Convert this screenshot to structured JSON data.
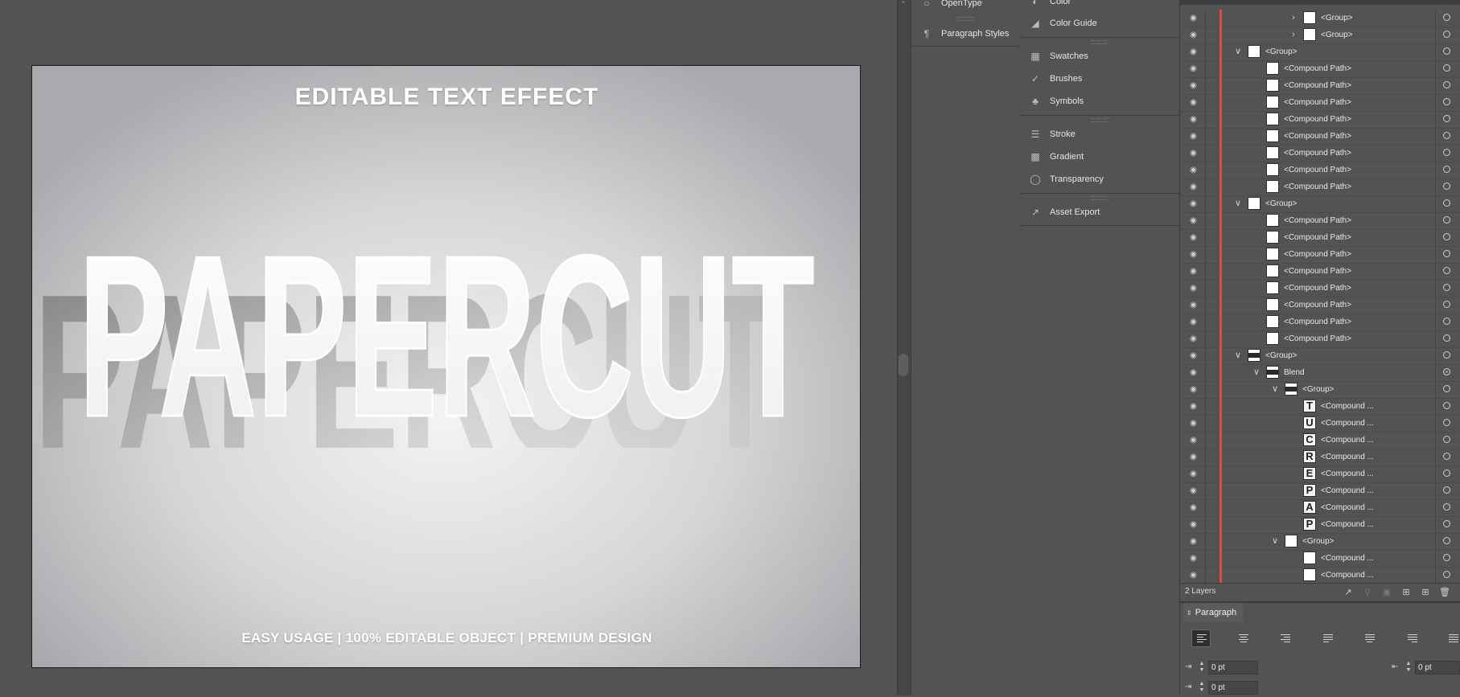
{
  "artboard": {
    "heading": "EDITABLE TEXT EFFECT",
    "main_text": "PAPERCUT",
    "footer": "EASY USAGE | 100% EDITABLE OBJECT | PREMIUM DESIGN"
  },
  "panel_col1": {
    "items": [
      {
        "label": "OpenType",
        "icon": "opentype-icon"
      },
      {
        "label": "Paragraph Styles",
        "icon": "paragraph-styles-icon"
      }
    ]
  },
  "panel_col2": {
    "items": [
      {
        "label": "Color",
        "icon": "color-icon"
      },
      {
        "label": "Color Guide",
        "icon": "color-guide-icon"
      },
      {
        "label": "Swatches",
        "icon": "swatches-icon"
      },
      {
        "label": "Brushes",
        "icon": "brushes-icon"
      },
      {
        "label": "Symbols",
        "icon": "symbols-icon"
      },
      {
        "label": "Stroke",
        "icon": "stroke-icon"
      },
      {
        "label": "Gradient",
        "icon": "gradient-icon"
      },
      {
        "label": "Transparency",
        "icon": "transparency-icon"
      },
      {
        "label": "Asset Export",
        "icon": "asset-export-icon"
      }
    ]
  },
  "layers": {
    "rows": [
      {
        "name": "<Group>",
        "indent": 5,
        "expanded": false,
        "has_chevron": true,
        "thumb": "letter"
      },
      {
        "name": "<Group>",
        "indent": 5,
        "expanded": false,
        "has_chevron": true,
        "thumb": "white"
      },
      {
        "name": "<Group>",
        "indent": 2,
        "expanded": true,
        "has_chevron": true,
        "thumb": "white"
      },
      {
        "name": "<Compound Path>",
        "indent": 3,
        "has_chevron": false,
        "thumb": "white"
      },
      {
        "name": "<Compound Path>",
        "indent": 3,
        "has_chevron": false,
        "thumb": "white"
      },
      {
        "name": "<Compound Path>",
        "indent": 3,
        "has_chevron": false,
        "thumb": "white"
      },
      {
        "name": "<Compound Path>",
        "indent": 3,
        "has_chevron": false,
        "thumb": "white"
      },
      {
        "name": "<Compound Path>",
        "indent": 3,
        "has_chevron": false,
        "thumb": "white"
      },
      {
        "name": "<Compound Path>",
        "indent": 3,
        "has_chevron": false,
        "thumb": "white"
      },
      {
        "name": "<Compound Path>",
        "indent": 3,
        "has_chevron": false,
        "thumb": "white"
      },
      {
        "name": "<Compound Path>",
        "indent": 3,
        "has_chevron": false,
        "thumb": "white"
      },
      {
        "name": "<Group>",
        "indent": 2,
        "expanded": true,
        "has_chevron": true,
        "thumb": "white"
      },
      {
        "name": "<Compound Path>",
        "indent": 3,
        "has_chevron": false,
        "thumb": "white"
      },
      {
        "name": "<Compound Path>",
        "indent": 3,
        "has_chevron": false,
        "thumb": "white"
      },
      {
        "name": "<Compound Path>",
        "indent": 3,
        "has_chevron": false,
        "thumb": "white"
      },
      {
        "name": "<Compound Path>",
        "indent": 3,
        "has_chevron": false,
        "thumb": "white"
      },
      {
        "name": "<Compound Path>",
        "indent": 3,
        "has_chevron": false,
        "thumb": "white"
      },
      {
        "name": "<Compound Path>",
        "indent": 3,
        "has_chevron": false,
        "thumb": "white"
      },
      {
        "name": "<Compound Path>",
        "indent": 3,
        "has_chevron": false,
        "thumb": "white"
      },
      {
        "name": "<Compound Path>",
        "indent": 3,
        "has_chevron": false,
        "thumb": "white"
      },
      {
        "name": "<Group>",
        "indent": 2,
        "expanded": true,
        "has_chevron": true,
        "thumb": "dark"
      },
      {
        "name": "Blend",
        "indent": 3,
        "expanded": true,
        "has_chevron": true,
        "thumb": "dark",
        "target": "filled"
      },
      {
        "name": "<Group>",
        "indent": 4,
        "expanded": true,
        "has_chevron": true,
        "thumb": "dark"
      },
      {
        "name": "<Compound ...",
        "indent": 5,
        "has_chevron": false,
        "thumb": "letter",
        "letter": "T"
      },
      {
        "name": "<Compound ...",
        "indent": 5,
        "has_chevron": false,
        "thumb": "letter",
        "letter": "U"
      },
      {
        "name": "<Compound ...",
        "indent": 5,
        "has_chevron": false,
        "thumb": "letter",
        "letter": "C"
      },
      {
        "name": "<Compound ...",
        "indent": 5,
        "has_chevron": false,
        "thumb": "letter",
        "letter": "R"
      },
      {
        "name": "<Compound ...",
        "indent": 5,
        "has_chevron": false,
        "thumb": "letter",
        "letter": "E"
      },
      {
        "name": "<Compound ...",
        "indent": 5,
        "has_chevron": false,
        "thumb": "letter",
        "letter": "P"
      },
      {
        "name": "<Compound ...",
        "indent": 5,
        "has_chevron": false,
        "thumb": "letter",
        "letter": "A"
      },
      {
        "name": "<Compound ...",
        "indent": 5,
        "has_chevron": false,
        "thumb": "letter",
        "letter": "P"
      },
      {
        "name": "<Group>",
        "indent": 4,
        "expanded": true,
        "has_chevron": true,
        "thumb": "white"
      },
      {
        "name": "<Compound ...",
        "indent": 5,
        "has_chevron": false,
        "thumb": "white"
      },
      {
        "name": "<Compound ...",
        "indent": 5,
        "has_chevron": false,
        "thumb": "white"
      }
    ],
    "count_label": "2 Layers"
  },
  "paragraph": {
    "tab_label": "Paragraph",
    "left_indent": "0 pt",
    "right_indent": "0 pt",
    "first_line_indent": "0 pt"
  },
  "colors": {
    "layer_color_bar": "#e04a4a",
    "canvas_bg": "#535353"
  }
}
